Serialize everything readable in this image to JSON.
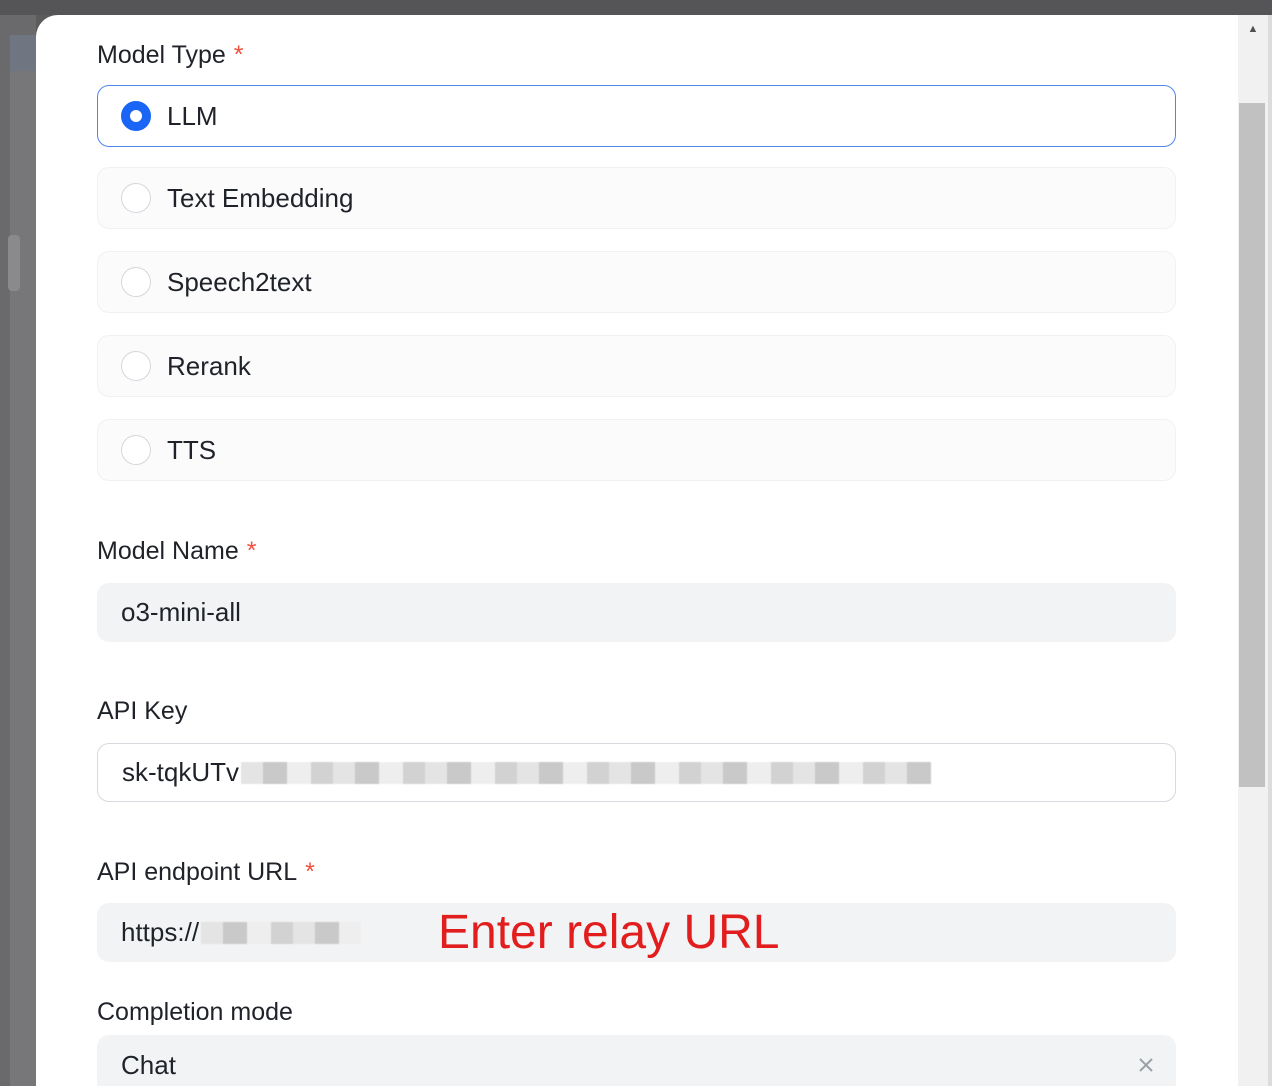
{
  "form": {
    "model_type": {
      "label": "Model Type",
      "required_mark": "*",
      "options": [
        {
          "label": "LLM",
          "selected": true
        },
        {
          "label": "Text Embedding",
          "selected": false
        },
        {
          "label": "Speech2text",
          "selected": false
        },
        {
          "label": "Rerank",
          "selected": false
        },
        {
          "label": "TTS",
          "selected": false
        }
      ]
    },
    "model_name": {
      "label": "Model Name",
      "required_mark": "*",
      "value": "o3-mini-all"
    },
    "api_key": {
      "label": "API Key",
      "value": "sk-tqkUTv"
    },
    "api_endpoint": {
      "label": "API endpoint URL",
      "required_mark": "*",
      "value": "https://"
    },
    "completion_mode": {
      "label": "Completion mode",
      "value": "Chat"
    }
  },
  "annotation": {
    "text": "Enter relay URL",
    "color": "#e21d1d"
  },
  "colors": {
    "accent": "#1a64f6",
    "required": "#f0503e"
  },
  "icons": {
    "scroll_up": "triangle-up-icon",
    "clear": "close-icon"
  }
}
